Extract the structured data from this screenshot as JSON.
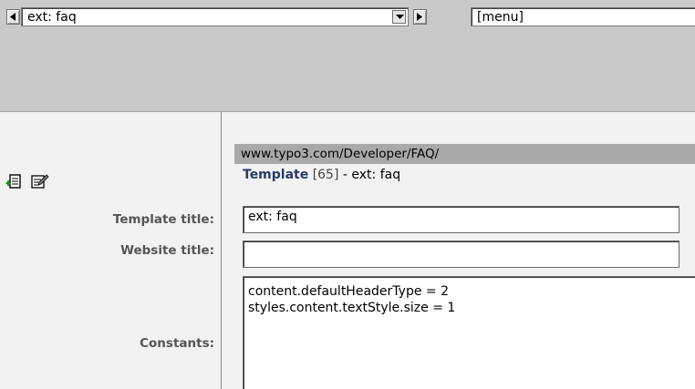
{
  "toolbar": {
    "template_select_value": "ext: faq",
    "menu_select_value": "[menu]"
  },
  "content": {
    "path": "www.typo3.com/Developer/FAQ/",
    "template_label": "Template",
    "template_id": "[65]",
    "template_suffix": " - ext: faq"
  },
  "form": {
    "template_title_label": "Template title:",
    "template_title_value": "ext: faq",
    "website_title_label": "Website title:",
    "website_title_value": "",
    "constants_label": "Constants:",
    "constants_value": "content.defaultHeaderType = 2\nstyles.content.textStyle.size = 1"
  },
  "icons": [
    "new-record-icon",
    "edit-record-icon"
  ],
  "colors": {
    "toolbar_bg": "#c9c9c9",
    "path_bar_bg": "#a9a9a9",
    "template_label": "#283a67"
  }
}
